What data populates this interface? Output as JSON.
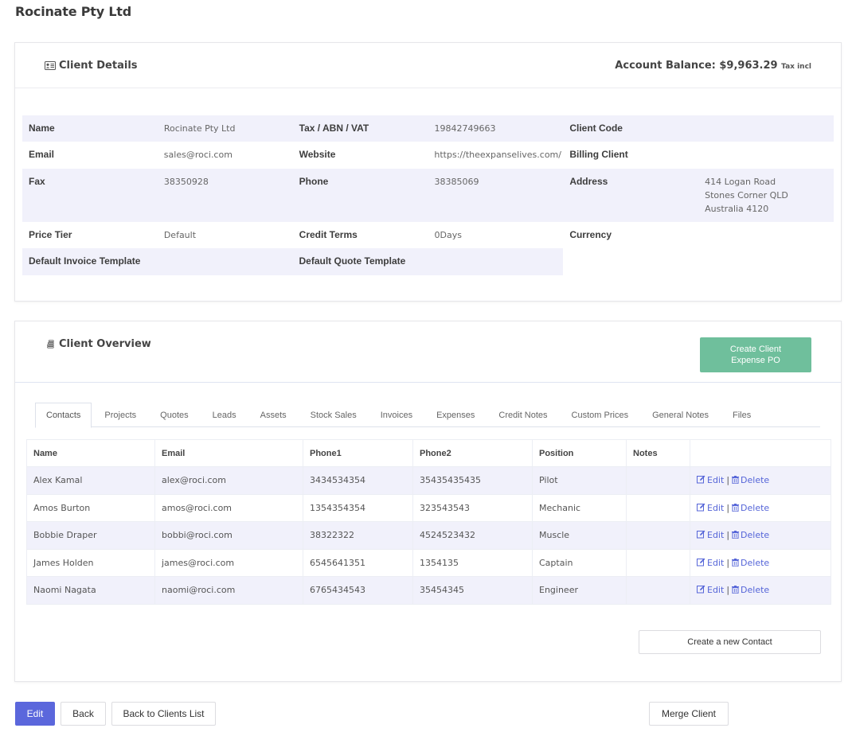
{
  "page_title": "Rocinate Pty Ltd",
  "client_details": {
    "title": "Client Details",
    "balance_label": "Account Balance: $9,963.29",
    "balance_suffix": "Tax incl",
    "fields": {
      "name_label": "Name",
      "name_value": "Rocinate Pty Ltd",
      "tax_label": "Tax / ABN / VAT",
      "tax_value": "19842749663",
      "client_code_label": "Client Code",
      "client_code_value": "",
      "email_label": "Email",
      "email_value": "sales@roci.com",
      "website_label": "Website",
      "website_value": "https://theexpanselives.com/",
      "billing_client_label": "Billing Client",
      "billing_client_value": "",
      "fax_label": "Fax",
      "fax_value": "38350928",
      "phone_label": "Phone",
      "phone_value": "38385069",
      "address_label": "Address",
      "address_line1": "414 Logan Road",
      "address_line2": "Stones Corner QLD",
      "address_line3": "Australia 4120",
      "price_tier_label": "Price Tier",
      "price_tier_value": "Default",
      "credit_terms_label": "Credit Terms",
      "credit_terms_value": "0Days",
      "currency_label": "Currency",
      "currency_value": "",
      "invoice_template_label": "Default Invoice Template",
      "invoice_template_value": "",
      "quote_template_label": "Default Quote Template",
      "quote_template_value": ""
    }
  },
  "client_overview": {
    "title": "Client Overview",
    "create_expense_label_line1": "Create Client",
    "create_expense_label_line2": "Expense PO",
    "tabs": [
      "Contacts",
      "Projects",
      "Quotes",
      "Leads",
      "Assets",
      "Stock Sales",
      "Invoices",
      "Expenses",
      "Credit Notes",
      "Custom Prices",
      "General Notes",
      "Files"
    ],
    "columns": [
      "Name",
      "Email",
      "Phone1",
      "Phone2",
      "Position",
      "Notes"
    ],
    "contacts": [
      {
        "name": "Alex Kamal",
        "email": "alex@roci.com",
        "phone1": "3434534354",
        "phone2": "35435435435",
        "position": "Pilot",
        "notes": ""
      },
      {
        "name": "Amos Burton",
        "email": "amos@roci.com",
        "phone1": "1354354354",
        "phone2": "323543543",
        "position": "Mechanic",
        "notes": ""
      },
      {
        "name": "Bobbie Draper",
        "email": "bobbi@roci.com",
        "phone1": "38322322",
        "phone2": "4524523432",
        "position": "Muscle",
        "notes": ""
      },
      {
        "name": "James Holden",
        "email": "james@roci.com",
        "phone1": "6545641351",
        "phone2": "1354135",
        "position": "Captain",
        "notes": ""
      },
      {
        "name": "Naomi Nagata",
        "email": "naomi@roci.com",
        "phone1": "6765434543",
        "phone2": "35454345",
        "position": "Engineer",
        "notes": ""
      }
    ],
    "edit_label": "Edit",
    "delete_label": "Delete",
    "separator": "|",
    "create_contact_label": "Create a new Contact"
  },
  "footer": {
    "edit_label": "Edit",
    "back_label": "Back",
    "back_list_label": "Back to Clients List",
    "merge_label": "Merge Client"
  },
  "colors": {
    "primary": "#5b67dc",
    "success": "#6fbf9c",
    "row_shade": "#f1f1fb",
    "link": "#5565d8"
  }
}
